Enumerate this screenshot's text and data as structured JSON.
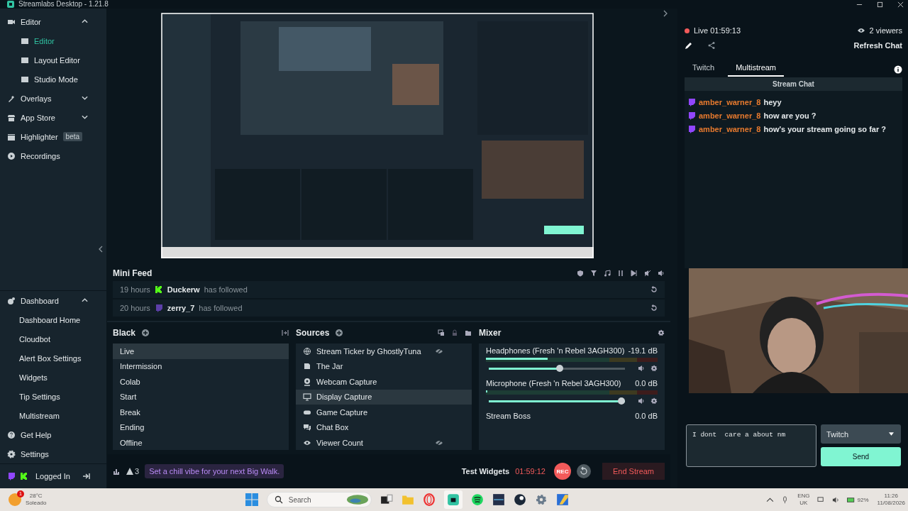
{
  "window": {
    "title": "Streamlabs Desktop - 1.21.8"
  },
  "sidebar": {
    "top": [
      {
        "kind": "group",
        "label": "Editor",
        "expanded": true,
        "children": [
          {
            "label": "Editor",
            "selected": true
          },
          {
            "label": "Layout Editor",
            "selected": false
          },
          {
            "label": "Studio Mode",
            "selected": false
          }
        ]
      },
      {
        "kind": "group",
        "label": "Overlays",
        "expanded": false
      },
      {
        "kind": "group",
        "label": "App Store",
        "expanded": false
      },
      {
        "kind": "link",
        "label": "Highlighter",
        "badge": "beta"
      },
      {
        "kind": "link",
        "label": "Recordings"
      }
    ],
    "bottom": [
      {
        "kind": "group",
        "label": "Dashboard",
        "expanded": true,
        "children": [
          {
            "label": "Dashboard Home",
            "selected": false
          },
          {
            "label": "Cloudbot",
            "selected": false
          },
          {
            "label": "Alert Box Settings",
            "selected": false
          },
          {
            "label": "Widgets",
            "selected": false
          },
          {
            "label": "Tip Settings",
            "selected": false
          },
          {
            "label": "Multistream",
            "selected": false
          }
        ]
      },
      {
        "kind": "link",
        "label": "Get Help"
      },
      {
        "kind": "link",
        "label": "Settings"
      }
    ],
    "account": {
      "label": "Logged In"
    }
  },
  "mini_feed": {
    "title": "Mini Feed",
    "events": [
      {
        "time": "19 hours",
        "kind": "kick",
        "user": "Duckerw",
        "action": "has followed"
      },
      {
        "time": "20 hours",
        "kind": "twitch",
        "user": "zerry_7",
        "action": "has followed"
      }
    ]
  },
  "scenes": {
    "collection": "Black",
    "items": [
      {
        "label": "Live",
        "selected": true
      },
      {
        "label": "Intermission",
        "selected": false
      },
      {
        "label": "Colab",
        "selected": false
      },
      {
        "label": "Start",
        "selected": false
      },
      {
        "label": "Break",
        "selected": false
      },
      {
        "label": "Ending",
        "selected": false
      },
      {
        "label": "Offline",
        "selected": false
      }
    ]
  },
  "sources": {
    "title": "Sources",
    "items": [
      {
        "kind": "browser",
        "label": "Stream Ticker by GhostlyTuna",
        "selected": false,
        "hidden": true
      },
      {
        "kind": "widget",
        "label": "The Jar",
        "selected": false,
        "hidden": false
      },
      {
        "kind": "webcam",
        "label": "Webcam Capture",
        "selected": false,
        "hidden": false
      },
      {
        "kind": "display",
        "label": "Display Capture",
        "selected": true,
        "hidden": false
      },
      {
        "kind": "game",
        "label": "Game Capture",
        "selected": false,
        "hidden": false
      },
      {
        "kind": "chat",
        "label": "Chat Box",
        "selected": false,
        "hidden": false
      },
      {
        "kind": "viewer",
        "label": "Viewer Count",
        "selected": false,
        "hidden": true
      }
    ]
  },
  "mixer": {
    "title": "Mixer",
    "channels": [
      {
        "name": "Headphones (Fresh 'n Rebel 3AGH300)",
        "reading": "-19.1 dB",
        "meter": {
          "level": 0.36
        },
        "volume": {
          "level": 0.52
        }
      },
      {
        "name": "Microphone (Fresh 'n Rebel 3AGH300)",
        "reading": "0.0 dB",
        "meter": {
          "level": 0.01
        },
        "volume": {
          "level": 1
        }
      },
      {
        "name": "Stream Boss",
        "reading": "0.0 dB"
      }
    ]
  },
  "bottom_bar": {
    "alerts": "3",
    "tip": "Set a chill vibe for your next Big Walk.",
    "test_widgets": "Test Widgets",
    "timer": "01:59:12",
    "rec": "REC",
    "end_stream": "End Stream"
  },
  "chat": {
    "status": "Live 01:59:13",
    "viewers": "2 viewers",
    "refresh": "Refresh Chat",
    "tabs": [
      {
        "label": "Twitch",
        "selected": false
      },
      {
        "label": "Multistream",
        "selected": true
      }
    ],
    "header": "Stream Chat",
    "messages": [
      {
        "user": "amber_warner_8",
        "text": "heyy"
      },
      {
        "user": "amber_warner_8",
        "text": "how are you ?"
      },
      {
        "user": "amber_warner_8",
        "text": "how's your stream going so far ?"
      }
    ],
    "input": {
      "value": "I dont  care a about nm"
    },
    "platform": "Twitch",
    "send": "Send"
  },
  "taskbar": {
    "weather": {
      "badge": "1",
      "temp": "28°C",
      "condition": "Soleado"
    },
    "search": {
      "placeholder": "Search"
    },
    "language": [
      "ENG",
      "UK"
    ],
    "battery": "92%",
    "clock": {
      "time": "11:26",
      "date": "11/08/2026"
    }
  }
}
